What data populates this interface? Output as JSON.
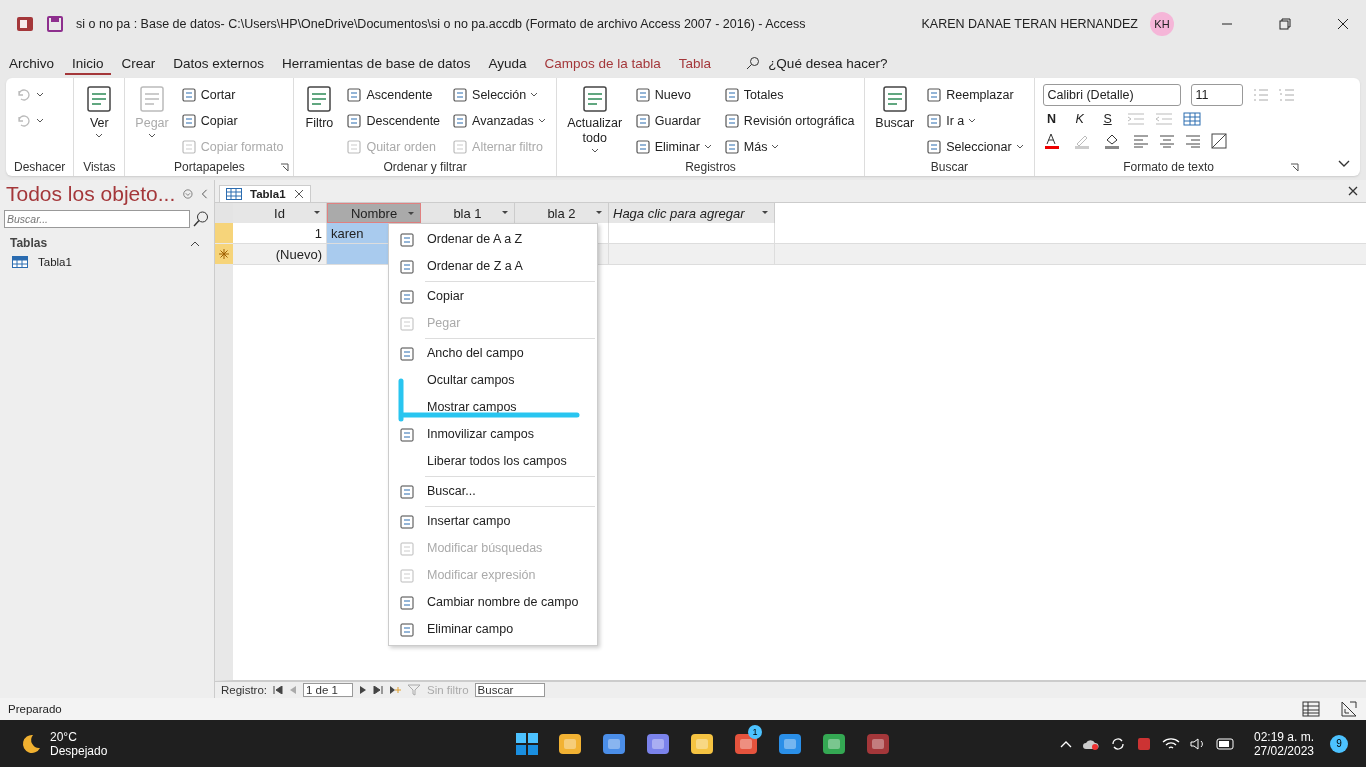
{
  "window": {
    "title": "si o no pa : Base de datos- C:\\Users\\HP\\OneDrive\\Documentos\\si o no pa.accdb (Formato de archivo Access 2007 - 2016)  -  Access",
    "user": "KAREN DANAE TERAN HERNANDEZ",
    "avatar": "KH"
  },
  "menu_tabs": [
    {
      "label": "Archivo",
      "selected": false,
      "contextual": false
    },
    {
      "label": "Inicio",
      "selected": true,
      "contextual": false
    },
    {
      "label": "Crear",
      "selected": false,
      "contextual": false
    },
    {
      "label": "Datos externos",
      "selected": false,
      "contextual": false
    },
    {
      "label": "Herramientas de base de datos",
      "selected": false,
      "contextual": false
    },
    {
      "label": "Ayuda",
      "selected": false,
      "contextual": false
    },
    {
      "label": "Campos de la tabla",
      "selected": false,
      "contextual": true
    },
    {
      "label": "Tabla",
      "selected": false,
      "contextual": true
    }
  ],
  "tell_me": "¿Qué desea hacer?",
  "ribbon": {
    "groups": [
      {
        "label": "Deshacer",
        "launcher": false,
        "buttons": [
          {
            "kind": "small",
            "disabled": true,
            "dropdown": true
          },
          {
            "kind": "small",
            "disabled": true,
            "dropdown": true
          }
        ]
      },
      {
        "label": "Vistas",
        "launcher": false,
        "buttons": [
          {
            "kind": "large",
            "label": "Ver",
            "disabled": false,
            "dropdown": true
          }
        ]
      },
      {
        "label": "Portapapeles",
        "launcher": true,
        "buttons": [
          {
            "kind": "large",
            "label": "Pegar",
            "disabled": true,
            "dropdown": true
          },
          {
            "kind": "small",
            "label": "Cortar",
            "disabled": false,
            "dropdown": false
          },
          {
            "kind": "small",
            "label": "Copiar",
            "disabled": false,
            "dropdown": false
          },
          {
            "kind": "small",
            "label": "Copiar formato",
            "disabled": true,
            "dropdown": false
          }
        ]
      },
      {
        "label": "Ordenar y filtrar",
        "launcher": false,
        "buttons": [
          {
            "kind": "large",
            "label": "Filtro",
            "disabled": false,
            "dropdown": false
          },
          {
            "kind": "small",
            "label": "Ascendente",
            "disabled": false,
            "dropdown": false
          },
          {
            "kind": "small",
            "label": "Descendente",
            "disabled": false,
            "dropdown": false
          },
          {
            "kind": "small",
            "label": "Quitar orden",
            "disabled": true,
            "dropdown": false
          },
          {
            "kind": "small",
            "label": "Selección",
            "disabled": false,
            "dropdown": true
          },
          {
            "kind": "small",
            "label": "Avanzadas",
            "disabled": false,
            "dropdown": true
          },
          {
            "kind": "small",
            "label": "Alternar filtro",
            "disabled": true,
            "dropdown": false
          }
        ]
      },
      {
        "label": "Registros",
        "launcher": false,
        "buttons": [
          {
            "kind": "large",
            "label": "Actualizar todo",
            "disabled": false,
            "dropdown": true
          },
          {
            "kind": "small",
            "label": "Nuevo",
            "disabled": false,
            "dropdown": false
          },
          {
            "kind": "small",
            "label": "Guardar",
            "disabled": false,
            "dropdown": false
          },
          {
            "kind": "small",
            "label": "Eliminar",
            "disabled": false,
            "dropdown": true
          },
          {
            "kind": "small",
            "label": "Totales",
            "disabled": false,
            "dropdown": false
          },
          {
            "kind": "small",
            "label": "Revisión ortográfica",
            "disabled": false,
            "dropdown": false
          },
          {
            "kind": "small",
            "label": "Más",
            "disabled": false,
            "dropdown": true
          }
        ]
      },
      {
        "label": "Buscar",
        "launcher": false,
        "buttons": [
          {
            "kind": "large",
            "label": "Buscar",
            "disabled": false,
            "dropdown": false
          },
          {
            "kind": "small",
            "label": "Reemplazar",
            "disabled": false,
            "dropdown": false
          },
          {
            "kind": "small",
            "label": "Ir a",
            "disabled": false,
            "dropdown": true
          },
          {
            "kind": "small",
            "label": "Seleccionar",
            "disabled": false,
            "dropdown": true
          }
        ]
      }
    ],
    "text_format": {
      "label": "Formato de texto",
      "font": "Calibri (Detalle)",
      "size": "11",
      "styles": [
        "N",
        "K",
        "S"
      ]
    }
  },
  "nav_pane": {
    "title": "Todos los objeto...",
    "search_placeholder": "Buscar...",
    "section": "Tablas",
    "items": [
      "Tabla1"
    ]
  },
  "document_tab": {
    "label": "Tabla1"
  },
  "datasheet": {
    "columns": [
      {
        "label": "Id",
        "selected": false,
        "italic": false
      },
      {
        "label": "Nombre",
        "selected": true,
        "italic": false
      },
      {
        "label": "bla 1",
        "selected": false,
        "italic": false
      },
      {
        "label": "bla 2",
        "selected": false,
        "italic": false
      },
      {
        "label": "Haga clic para agregar",
        "selected": false,
        "italic": true
      }
    ],
    "rows": [
      {
        "new_record": false,
        "cells": [
          "1",
          "karen",
          "",
          "",
          ""
        ]
      },
      {
        "new_record": true,
        "cells": [
          "(Nuevo)",
          "",
          "",
          "",
          ""
        ]
      }
    ]
  },
  "context_menu": [
    {
      "label": "Ordenar de A a Z",
      "disabled": false,
      "icon": true,
      "separator_after": false
    },
    {
      "label": "Ordenar de Z a A",
      "disabled": false,
      "icon": true,
      "separator_after": true
    },
    {
      "label": "Copiar",
      "disabled": false,
      "icon": true,
      "separator_after": false
    },
    {
      "label": "Pegar",
      "disabled": true,
      "icon": true,
      "separator_after": true
    },
    {
      "label": "Ancho del campo",
      "disabled": false,
      "icon": true,
      "separator_after": false
    },
    {
      "label": "Ocultar campos",
      "disabled": false,
      "icon": false,
      "separator_after": false
    },
    {
      "label": "Mostrar campos",
      "disabled": false,
      "icon": false,
      "separator_after": false
    },
    {
      "label": "Inmovilizar campos",
      "disabled": false,
      "icon": true,
      "separator_after": false
    },
    {
      "label": "Liberar todos los campos",
      "disabled": false,
      "icon": false,
      "separator_after": true
    },
    {
      "label": "Buscar...",
      "disabled": false,
      "icon": true,
      "separator_after": true
    },
    {
      "label": "Insertar campo",
      "disabled": false,
      "icon": true,
      "separator_after": false
    },
    {
      "label": "Modificar búsquedas",
      "disabled": true,
      "icon": true,
      "separator_after": false
    },
    {
      "label": "Modificar expresión",
      "disabled": true,
      "icon": true,
      "separator_after": false
    },
    {
      "label": "Cambiar nombre de campo",
      "disabled": false,
      "icon": true,
      "separator_after": false
    },
    {
      "label": "Eliminar campo",
      "disabled": false,
      "icon": true,
      "separator_after": false
    }
  ],
  "record_nav": {
    "label": "Registro:",
    "position": "1 de 1",
    "filter": "Sin filtro",
    "search": "Buscar"
  },
  "status_bar": {
    "text": "Preparado"
  },
  "taskbar": {
    "temperature": "20°C",
    "weather": "Despejado",
    "mail_badge": "1",
    "time": "02:19 a. m.",
    "date": "27/02/2023",
    "notifications": "9"
  }
}
